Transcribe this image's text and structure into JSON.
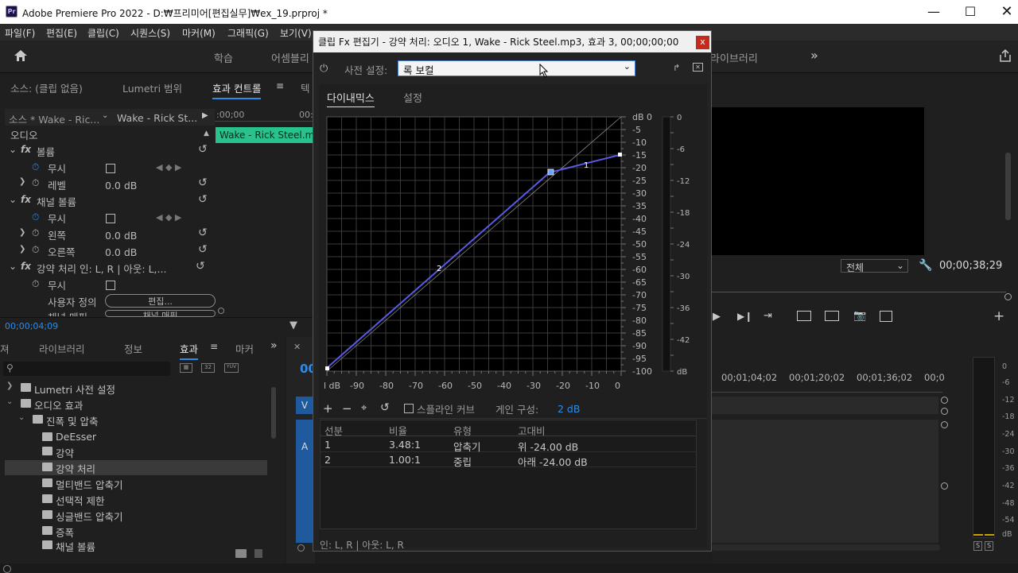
{
  "app": {
    "title": "Adobe Premiere Pro 2022 - D:₩프리미어[편집실무]₩ex_19.prproj *",
    "icon_text": "Pr",
    "accent": "#9b80ff"
  },
  "menus": [
    "파일(F)",
    "편집(E)",
    "클립(C)",
    "시퀀스(S)",
    "마커(M)",
    "그래픽(G)",
    "보기(V)"
  ],
  "workspaces": [
    "학습",
    "어셈블리",
    "라이브러리"
  ],
  "source_panel": {
    "tabs": [
      "소스: (클립 없음)",
      "Lumetri 범위",
      "효과 컨트롤",
      "텍"
    ],
    "source_clip": "소스 * Wake - Ric...",
    "target_clip": "Wake - Rick St...",
    "time_start": ":00;00",
    "time_end": "00:",
    "clip_bar": "Wake - Rick Steel.mp",
    "section": "오디오",
    "effects": [
      {
        "fx": "fx",
        "name": "볼륨"
      },
      {
        "fx": "fx",
        "name": "채널 볼륨"
      },
      {
        "fx": "fx",
        "name": "강약 처리 인: L, R | 아웃: L,..."
      }
    ],
    "params": {
      "bypass": "무시",
      "level": "레벨",
      "level_val": "0.0 dB",
      "left": "왼쪽",
      "left_val": "0.0 dB",
      "right": "오른쪽",
      "right_val": "0.0 dB",
      "custom": "사용자 정의",
      "edit_btn": "편집...",
      "channel_map": "채널 매핑",
      "map_btn": "채널 매핑"
    },
    "timecode": "00;00;04;09"
  },
  "effects_panel": {
    "tabs": [
      "져",
      "라이브러리",
      "정보",
      "효과",
      "마커"
    ],
    "tree": [
      {
        "label": "Lumetri 사전 설정",
        "level": 0
      },
      {
        "label": "오디오 효과",
        "level": 0
      },
      {
        "label": "진폭 및 압축",
        "level": 1
      },
      {
        "label": "DeEsser",
        "level": 2
      },
      {
        "label": "강약",
        "level": 2
      },
      {
        "label": "강약 처리",
        "level": 2,
        "selected": true
      },
      {
        "label": "멀티밴드 압축기",
        "level": 2
      },
      {
        "label": "선택적 제한",
        "level": 2
      },
      {
        "label": "싱글밴드 압축기",
        "level": 2
      },
      {
        "label": "증폭",
        "level": 2
      },
      {
        "label": "채널 볼륨",
        "level": 2
      }
    ]
  },
  "program": {
    "zoom": "전체",
    "timecode": "00;00;38;29"
  },
  "timeline": {
    "ruler": [
      "00;01;04;02",
      "00;01;20;02",
      "00;01;36;02",
      "00;0"
    ],
    "track_v": "V",
    "track_a": "A",
    "sequence_time": "00"
  },
  "meters": {
    "scale": [
      "0",
      "-6",
      "-12",
      "-18",
      "-24",
      "-30",
      "-36",
      "-42",
      "-48",
      "-54",
      "dB"
    ],
    "solo": [
      "S",
      "S"
    ]
  },
  "dialog": {
    "title": "클립 Fx 편집기 - 강약 처리: 오디오 1, Wake - Rick Steel.mp3, 효과 3, 00;00;00;00",
    "close": "x",
    "preset_label": "사전 설정:",
    "preset_value": "록 보컬",
    "tabs": [
      "다이내믹스",
      "설정"
    ],
    "y_labels": [
      "dB 0",
      "-5",
      "-10",
      "-15",
      "-20",
      "-25",
      "-30",
      "-35",
      "-40",
      "-45",
      "-50",
      "-55",
      "-60",
      "-65",
      "-70",
      "-75",
      "-80",
      "-85",
      "-90",
      "-95",
      "-100"
    ],
    "x_labels": [
      "l dB",
      "-90",
      "-80",
      "-70",
      "-60",
      "-50",
      "-40",
      "-30",
      "-20",
      "-10",
      "0"
    ],
    "meter_labels": [
      "0",
      "-6",
      "-12",
      "-18",
      "-24",
      "-30",
      "-36",
      "-42",
      "dB"
    ],
    "point_labels": [
      "1",
      "2"
    ],
    "spline_label": "스플라인 커브",
    "gain_label": "게인 구성:",
    "gain_value": "2 dB",
    "table_headers": [
      "선분",
      "비율",
      "유형",
      "고대비"
    ],
    "table_rows": [
      {
        "seg": "1",
        "ratio": "3.48:1",
        "type": "압축기",
        "thresh": "위 -24.00 dB"
      },
      {
        "seg": "2",
        "ratio": "1.00:1",
        "type": "중립",
        "thresh": "아래 -24.00 dB"
      }
    ],
    "io_label": "인: L, R | 아웃: L, R",
    "curve_color": "#5a5ae6"
  }
}
